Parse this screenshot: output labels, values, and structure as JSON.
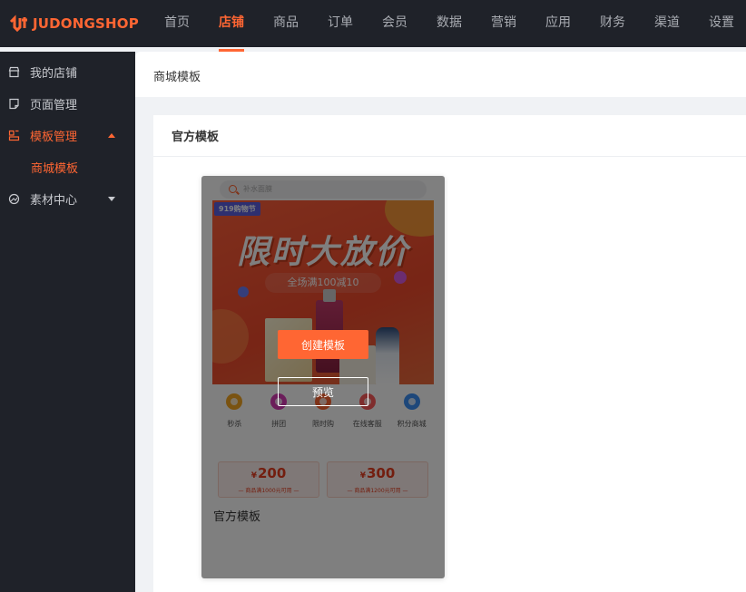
{
  "brand": {
    "name": "JUDONGSHOP",
    "accent": "#ff6633"
  },
  "topnav": {
    "items": [
      {
        "label": "首页",
        "active": false
      },
      {
        "label": "店铺",
        "active": true
      },
      {
        "label": "商品",
        "active": false
      },
      {
        "label": "订单",
        "active": false
      },
      {
        "label": "会员",
        "active": false
      },
      {
        "label": "数据",
        "active": false
      },
      {
        "label": "营销",
        "active": false
      },
      {
        "label": "应用",
        "active": false
      },
      {
        "label": "财务",
        "active": false
      },
      {
        "label": "渠道",
        "active": false
      },
      {
        "label": "设置",
        "active": false
      }
    ]
  },
  "sidebar": {
    "items": [
      {
        "label": "我的店铺",
        "icon": "store-icon"
      },
      {
        "label": "页面管理",
        "icon": "page-icon"
      },
      {
        "label": "模板管理",
        "icon": "template-icon",
        "active": true,
        "expanded": true
      },
      {
        "label": "商城模板",
        "sub": true,
        "active": true
      },
      {
        "label": "素材中心",
        "icon": "material-icon",
        "expanded": false
      }
    ]
  },
  "page": {
    "title": "商城模板"
  },
  "panel": {
    "title": "官方模板"
  },
  "template_card": {
    "name": "官方模板",
    "preview": {
      "search_placeholder": "补水面膜",
      "banner_tag": "919购物节",
      "banner_title": "限时大放价",
      "banner_subtitle": "全场满100减10",
      "categories": [
        {
          "label": "秒杀",
          "color": "#f5a623"
        },
        {
          "label": "拼团",
          "color": "#d63bb5"
        },
        {
          "label": "限时购",
          "color": "#ff6633"
        },
        {
          "label": "在线客服",
          "color": "#ff5a5a"
        },
        {
          "label": "积分商城",
          "color": "#3b8ef5"
        }
      ],
      "coupons": [
        {
          "currency": "¥",
          "amount": "200",
          "condition": "— 商品满1000元可用 —"
        },
        {
          "currency": "¥",
          "amount": "300",
          "condition": "— 商品满1200元可用 —"
        }
      ]
    },
    "actions": {
      "create_label": "创建模板",
      "preview_label": "预览"
    }
  }
}
